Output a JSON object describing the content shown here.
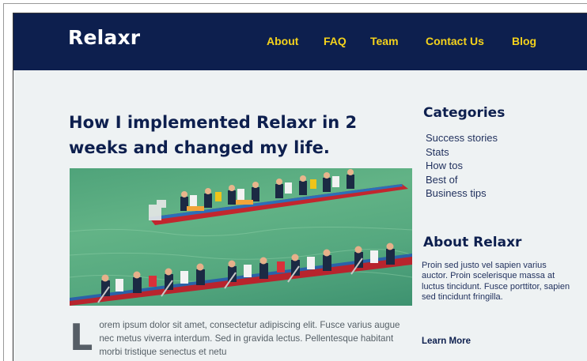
{
  "header": {
    "brand": "Relaxr",
    "nav": [
      "About",
      "FAQ",
      "Team",
      "Contact Us",
      "Blog"
    ]
  },
  "article": {
    "title": "How I implemented Relaxr in 2 weeks and changed my life.",
    "image_icon": "dragon-boat-photo",
    "dropcap": "L",
    "body": "orem ipsum dolor sit amet, consectetur adipiscing elit. Fusce varius augue nec metus viverra interdum. Sed in gravida lectus. Pellentesque habitant morbi tristique senectus et netu"
  },
  "sidebar": {
    "categories_title": "Categories",
    "categories": [
      "Success stories",
      "Stats",
      "How tos",
      "Best of",
      "Business tips"
    ],
    "about_title": "About Relaxr",
    "about_text": "Proin sed justo vel sapien varius auctor. Proin scelerisque massa at luctus tincidunt. Fusce porttitor, sapien sed tincidunt fringilla.",
    "learn_more": "Learn More"
  },
  "colors": {
    "navbar": "#0d1f4e",
    "nav_link": "#f4d21c",
    "background": "#eef2f3"
  }
}
